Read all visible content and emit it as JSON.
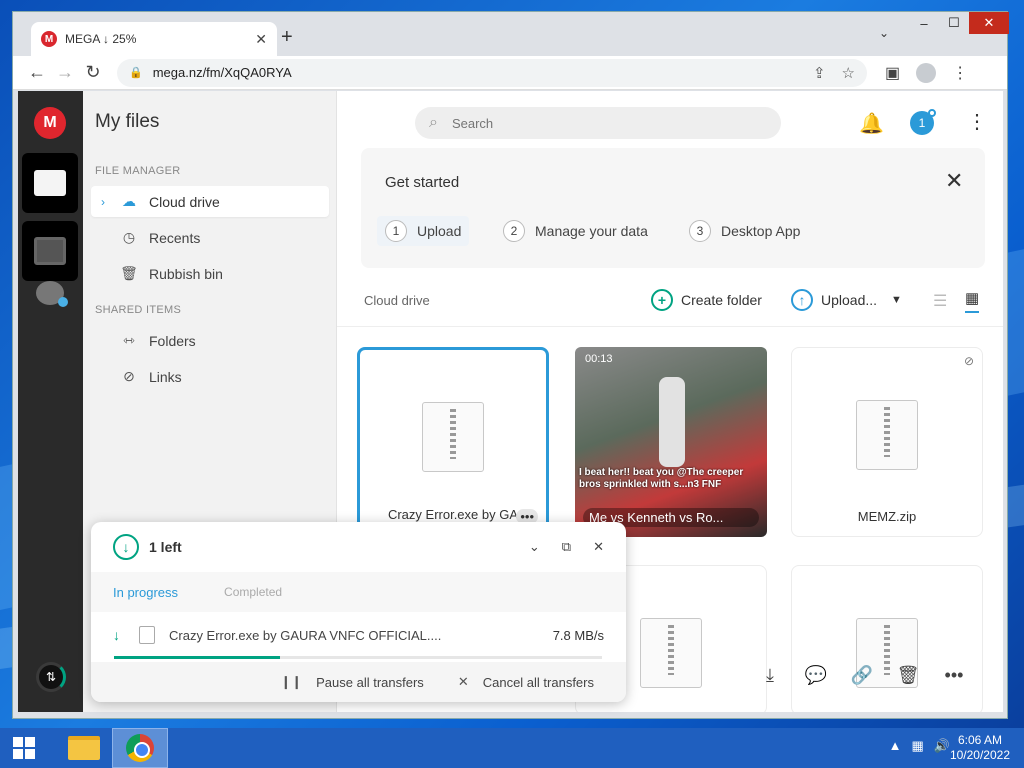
{
  "browser": {
    "tab_title": "MEGA ↓ 25%",
    "tab_close": "✕",
    "new_tab": "+",
    "url": "mega.nz/fm/XqQA0RYA"
  },
  "sidebar": {
    "title": "My files",
    "file_manager_label": "FILE MANAGER",
    "items": [
      {
        "label": "Cloud drive",
        "icon": "cloud-icon"
      },
      {
        "label": "Recents",
        "icon": "clock-icon"
      },
      {
        "label": "Rubbish bin",
        "icon": "trash-icon"
      }
    ],
    "shared_label": "SHARED ITEMS",
    "shared_items": [
      {
        "label": "Folders",
        "icon": "shared-folder-icon"
      },
      {
        "label": "Links",
        "icon": "link-icon"
      }
    ]
  },
  "header": {
    "search_placeholder": "Search",
    "avatar_letter": "1"
  },
  "get_started": {
    "title": "Get started",
    "steps": [
      {
        "num": "1",
        "label": "Upload"
      },
      {
        "num": "2",
        "label": "Manage your data"
      },
      {
        "num": "3",
        "label": "Desktop App"
      }
    ]
  },
  "toolbar": {
    "breadcrumb": "Cloud drive",
    "create_folder": "Create folder",
    "upload": "Upload..."
  },
  "files": [
    {
      "name": "Crazy Error.exe by GA",
      "type": "zip",
      "selected": true
    },
    {
      "name": "Me vs Kenneth vs Ro...",
      "type": "video",
      "duration": "00:13",
      "caption": "I beat her!! beat you @The creeper bros sprinkled with s...n3 FNF"
    },
    {
      "name": "MEMZ.zip",
      "type": "zip",
      "linked": true
    }
  ],
  "transfer": {
    "count_label": "1 left",
    "tab_in_progress": "In progress",
    "tab_completed": "Completed",
    "file_name": "Crazy Error.exe by GAURA VNFC OFFICIAL....",
    "speed": "7.8 MB/s",
    "progress": 0.34,
    "pause_all": "Pause all transfers",
    "cancel_all": "Cancel all transfers"
  },
  "taskbar": {
    "time": "6:06 AM",
    "date": "10/20/2022"
  },
  "colors": {
    "mega_red": "#e0262e",
    "accent_blue": "#2b9ad8",
    "accent_green": "#00a382"
  }
}
